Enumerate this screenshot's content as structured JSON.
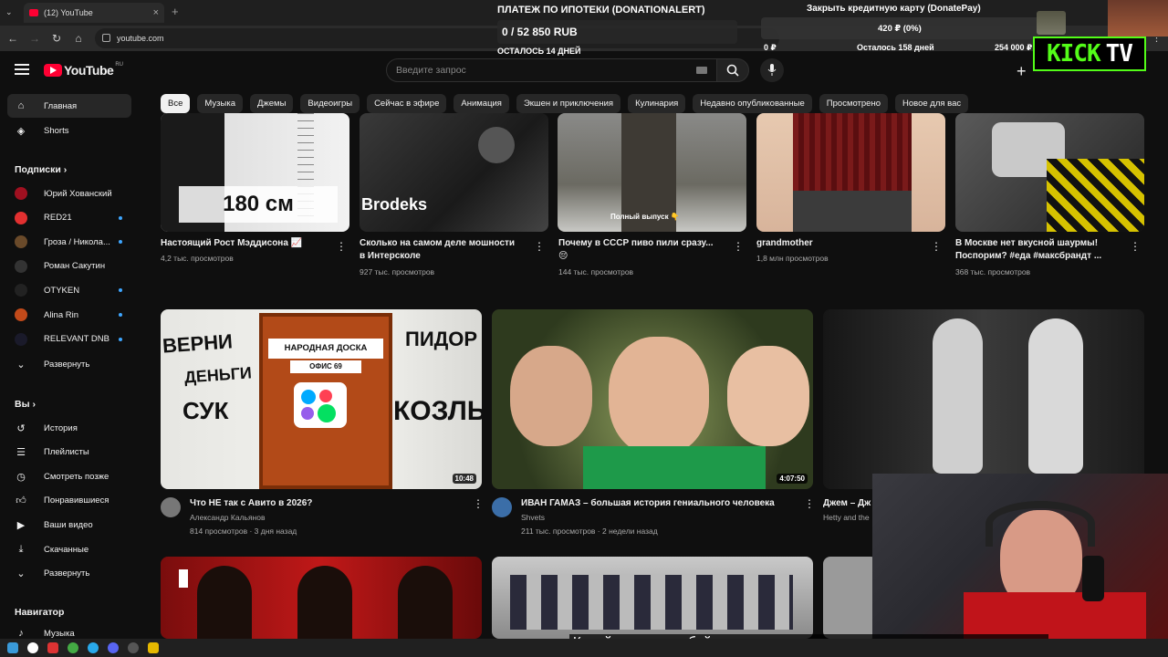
{
  "browser": {
    "tab_title": "(12) YouTube",
    "url": "youtube.com"
  },
  "header": {
    "logo_text": "YouTube",
    "region": "RU",
    "search_placeholder": "Введите запрос"
  },
  "chips": [
    "Все",
    "Музыка",
    "Джемы",
    "Видеоигры",
    "Сейчас в эфире",
    "Анимация",
    "Экшен и приключения",
    "Кулинария",
    "Недавно опубликованные",
    "Просмотрено",
    "Новое для вас"
  ],
  "sidebar": {
    "main": [
      {
        "label": "Главная",
        "icon": "home-icon"
      },
      {
        "label": "Shorts",
        "icon": "shorts-icon"
      }
    ],
    "subscriptions_title": "Подписки",
    "subscriptions": [
      {
        "label": "Юрий Хованский",
        "dot": false
      },
      {
        "label": "RED21",
        "dot": true
      },
      {
        "label": "Гроза / Никола...",
        "dot": true
      },
      {
        "label": "Роман Сакутин",
        "dot": false
      },
      {
        "label": "OTYKEN",
        "dot": true
      },
      {
        "label": "Alina Rin",
        "dot": true
      },
      {
        "label": "RELEVANT DNB",
        "dot": true
      }
    ],
    "expand_label": "Развернуть",
    "you_title": "Вы",
    "you": [
      {
        "label": "История",
        "icon": "history-icon"
      },
      {
        "label": "Плейлисты",
        "icon": "playlists-icon"
      },
      {
        "label": "Смотреть позже",
        "icon": "watch-later-icon"
      },
      {
        "label": "Понравившиеся",
        "icon": "like-icon"
      },
      {
        "label": "Ваши видео",
        "icon": "your-videos-icon"
      },
      {
        "label": "Скачанные",
        "icon": "download-icon"
      },
      {
        "label": "Развернуть",
        "icon": "chevron-down-icon"
      }
    ],
    "navigator_title": "Навигатор",
    "navigator": [
      {
        "label": "Музыка",
        "icon": "music-icon"
      }
    ]
  },
  "shorts_row": [
    {
      "title": "Настоящий Рост Мэддисона 📈",
      "title2": "",
      "meta": "4,2 тыс. просмотров",
      "overlay": "180 см"
    },
    {
      "title": "Сколько на самом деле  мошности",
      "title2": "в Интерсколе",
      "meta": "927 тыс. просмотров",
      "overlay": "Brodeks"
    },
    {
      "title": "Почему в СССР пиво пили сразу...",
      "title2": "😔",
      "meta": "144 тыс. просмотров",
      "overlay": "Полный выпуск 👇"
    },
    {
      "title": "grandmother",
      "title2": "",
      "meta": "1,8 млн просмотров",
      "overlay": ""
    },
    {
      "title": "В Москве нет вкусной шаурмы!",
      "title2": "Поспорим? #еда #максбрандт ...",
      "meta": "368 тыс. просмотров",
      "overlay": ""
    }
  ],
  "videos": [
    {
      "title": "Что НЕ так с Авито в 2026?",
      "channel": "Александр Кальянов",
      "meta": "814 просмотров · 3 дня назад",
      "duration": "10:48",
      "thumb_texts": {
        "a": "ВЕРНИ",
        "b": "ДЕНЬГИ",
        "c": "СУК",
        "d": "НАРОДНАЯ ДОСКА",
        "e": "ОФИС 69",
        "f": "ПИДОР",
        "g": "КОЗЛЫ"
      }
    },
    {
      "title": "ИВАН ГАМАЗ – большая история гениального человека",
      "channel": "Shvets",
      "meta": "211 тыс. просмотров · 2 недели назад",
      "duration": "4:07:50"
    },
    {
      "title": "Джем – Дж",
      "channel": "Hetty and the",
      "meta": "",
      "duration": ""
    }
  ],
  "overlays": {
    "ipoteka_title": "ПЛАТЕЖ ПО ИПОТЕКИ (DONATIONALERT)",
    "ipoteka_value": "0 / 52 850 RUB",
    "ipoteka_remaining": "ОСТАЛОСЬ 14 ДНЕЙ",
    "credit_title": "Закрыть кредитную карту (DonatePay)",
    "credit_value": "420 ₽ (0%)",
    "credit_low": "0 ₽",
    "credit_mid": "Осталось 158 дней",
    "credit_high": "254 000 ₽",
    "kick_a": "KICK",
    "kick_b": "TV",
    "subtitle": "Кидайте донат любой посмотрю сколько захочу ваш видос хоть за миньку"
  },
  "colors": {
    "brand": "#ff0033",
    "kick": "#53fc18",
    "bg": "#0f0f0f",
    "dot": "#3ea6ff"
  }
}
